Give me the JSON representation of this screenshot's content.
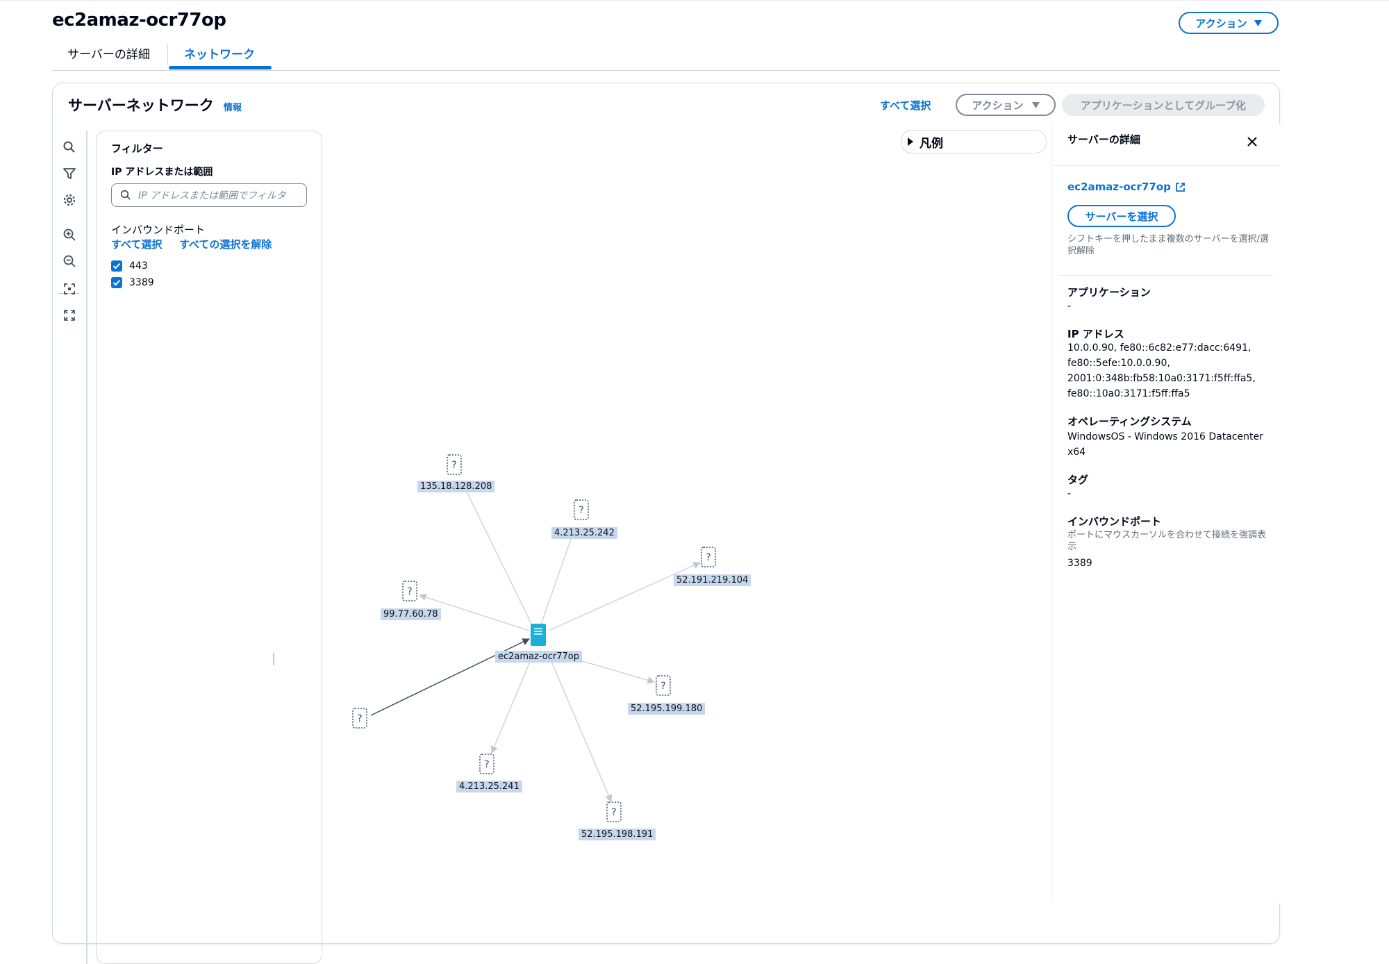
{
  "page": {
    "title": "ec2amaz-ocr77op",
    "action_button": "アクション"
  },
  "tabs": [
    {
      "label": "サーバーの詳細",
      "active": false
    },
    {
      "label": "ネットワーク",
      "active": true
    }
  ],
  "network": {
    "title": "サーバーネットワーク",
    "info_link": "情報",
    "select_all": "すべて選択",
    "action_button": "アクション",
    "group_button": "アプリケーションとしてグループ化",
    "legend_label": "凡例"
  },
  "toolbar": [
    "search-icon",
    "filter-icon",
    "settings-icon",
    "zoom-in-icon",
    "zoom-out-icon",
    "fit-view-icon",
    "expand-icon"
  ],
  "filter": {
    "title": "フィルター",
    "ip_label": "IP アドレスまたは範囲",
    "ip_placeholder": "IP アドレスまたは範囲でフィルタ",
    "ports_label": "インバウンドポート",
    "select_all": "すべて選択",
    "deselect_all": "すべての選択を解除",
    "ports": [
      {
        "label": "443",
        "checked": true
      },
      {
        "label": "3389",
        "checked": true
      }
    ]
  },
  "graph": {
    "center": {
      "label": "ec2amaz-ocr77op"
    },
    "nodes": [
      {
        "label": "135.18.128.208"
      },
      {
        "label": "4.213.25.242"
      },
      {
        "label": "52.191.219.104"
      },
      {
        "label": "99.77.60.78"
      },
      {
        "label": "52.195.199.180"
      },
      {
        "label": "4.213.25.241"
      },
      {
        "label": "52.195.198.191"
      },
      {
        "label": ""
      }
    ]
  },
  "details": {
    "title": "サーバーの詳細",
    "server_link": "ec2amaz-ocr77op",
    "select_button": "サーバーを選択",
    "hint": "シフトキーを押したまま複数のサーバーを選択/選択解除",
    "application_label": "アプリケーション",
    "application_value": "-",
    "ip_label": "IP アドレス",
    "ip_lines": [
      "10.0.0.90, fe80::6c82:e77:dacc:6491,",
      "fe80::5efe:10.0.0.90,",
      "2001:0:348b:fb58:10a0:3171:f5ff:ffa5,",
      "fe80::10a0:3171:f5ff:ffa5"
    ],
    "os_label": "オペレーティングシステム",
    "os_value": "WindowsOS - Windows 2016 Datacenter x64",
    "tags_label": "タグ",
    "tags_value": "-",
    "ports_label": "インバウンドポート",
    "ports_hint": "ポートにマウスカーソルを合わせて接続を強調表示",
    "ports_value": "3389"
  },
  "colors": {
    "accent": "#0972d3",
    "server_node": "#1ab0d8",
    "label_bg": "#c7d8ee"
  }
}
